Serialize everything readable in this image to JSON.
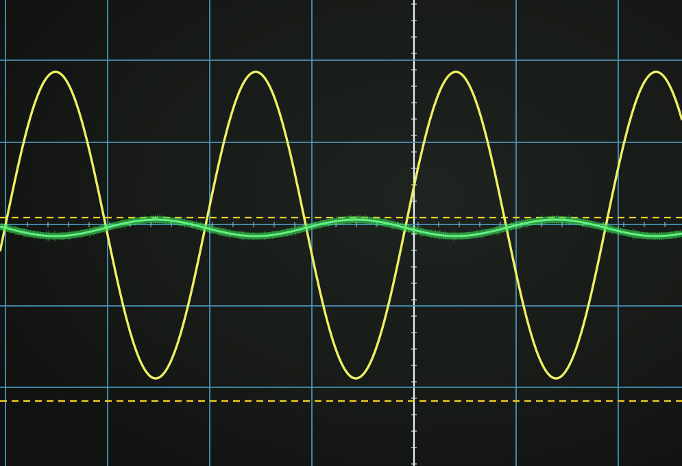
{
  "chart_data": {
    "type": "line",
    "title": "",
    "xlabel": "",
    "ylabel": "",
    "grid": true,
    "grid_color": "#4a93b8",
    "background_color": "#161815",
    "x_divisions": 6.6,
    "y_divisions": 5.7,
    "xlim": [
      0,
      6.6
    ],
    "ylim": [
      -3.0,
      2.7
    ],
    "series": [
      {
        "shape": "sine",
        "color": "#eef062",
        "amplitude_div": 1.88,
        "offset_div": 0.0,
        "period_div": 1.96,
        "crossings_div": [
          0.0,
          1.04,
          2.04,
          3.0,
          4.0,
          5.0,
          6.0
        ],
        "peaks_div": [
          0.52,
          2.52,
          4.52,
          6.46
        ],
        "troughs_div": [
          1.54,
          3.54,
          5.54
        ]
      },
      {
        "shape": "sine",
        "color": "#32d84e",
        "amplitude_div": 0.09,
        "offset_div": 0.0,
        "period_div": 1.96,
        "trace_thickness_div": 0.07
      }
    ],
    "reference_lines": [
      {
        "color": "#f5cf2a",
        "style": "dashed",
        "y_div": 0.02
      },
      {
        "color": "#f5cf2a",
        "style": "dashed",
        "y_div": -2.23
      }
    ]
  }
}
